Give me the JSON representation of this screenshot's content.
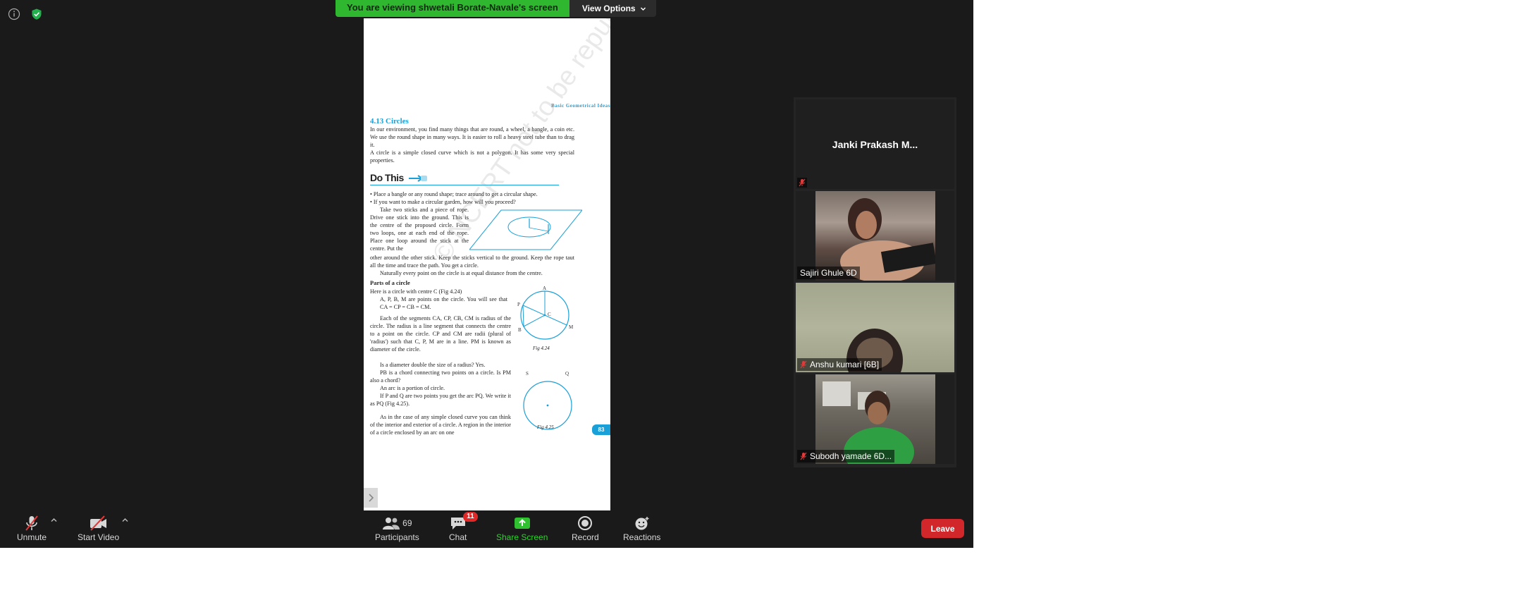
{
  "banner": {
    "viewing_text": "You are viewing shwetali Borate-Navale's screen",
    "view_options_label": "View Options"
  },
  "document": {
    "running_head": "Basic Geometrical Ideas",
    "section_title": "4.13  Circles",
    "intro_1": "In our environment, you find many things that are round, a wheel, a bangle, a coin etc. We use the round shape in many ways. It is easier to roll a heavy steel tube than to drag it.",
    "intro_2": "A circle is a simple closed curve which is not a polygon. It has some very special properties.",
    "do_this": "Do This",
    "bullet_1": "•   Place a bangle or any round shape; trace around to get a circular shape.",
    "bullet_2": "•   If you want to make a circular garden, how will you proceed?",
    "activity": "Take two sticks and a piece of rope. Drive one stick into the ground. This is the centre of the proposed circle. Form two loops, one at each end of the rope. Place one loop around the stick at the centre. Put the",
    "activity_2": "other around the other stick. Keep the sticks vertical to the ground. Keep the rope taut all the time and trace the path. You get a circle.",
    "activity_3": "Naturally every point on the circle is at equal distance from the centre.",
    "parts_heading": "Parts of a circle",
    "parts_1": "Here is a circle with centre C (Fig 4.24)",
    "parts_2": "A, P, B, M are points on the circle. You will see that CA = CP = CB = CM.",
    "parts_3": "Each of the segments CA, CP, CB, CM is radius of the circle. The radius is a line segment that connects the centre to a point on the circle. CP and CM are radii (plural of 'radius') such that C, P, M are in a line. PM is known as diameter of the circle.",
    "parts_4": "Is a diameter double the size of a radius? Yes.",
    "parts_5": "PB is a chord connecting two points on a circle. Is PM also a chord?",
    "parts_6": "An arc is a portion of circle.",
    "parts_7": "If P and Q are two points you get the arc PQ. We write it as PQ (Fig 4.25).",
    "parts_8": "As in the case of any simple closed curve you can think of the interior and exterior of a circle. A region in the interior of a circle enclosed by an arc on one",
    "fig_424": "Fig 4.24",
    "fig_425": "Fig 4.25",
    "page_number": "83",
    "watermark": "© NCERT not to be republished",
    "labels": {
      "a": "A",
      "p": "P",
      "b": "B",
      "m": "M",
      "c": "C",
      "s": "S",
      "q": "Q"
    }
  },
  "participants": [
    {
      "name": "Janki Prakash M...",
      "muted": true,
      "video": false
    },
    {
      "name": "Sajiri Ghule 6D",
      "muted": false,
      "video": true
    },
    {
      "name": "Anshu kumari [6B]",
      "muted": true,
      "video": true
    },
    {
      "name": "Subodh yamade 6D...",
      "muted": true,
      "video": true
    }
  ],
  "toolbar": {
    "unmute": "Unmute",
    "start_video": "Start Video",
    "participants": "Participants",
    "participants_count": "69",
    "chat": "Chat",
    "chat_badge": "11",
    "share_screen": "Share Screen",
    "record": "Record",
    "reactions": "Reactions",
    "leave": "Leave"
  },
  "colors": {
    "share_green": "#2fb82f",
    "leave_red": "#d1262a",
    "ncert_blue": "#1aa0d8"
  }
}
